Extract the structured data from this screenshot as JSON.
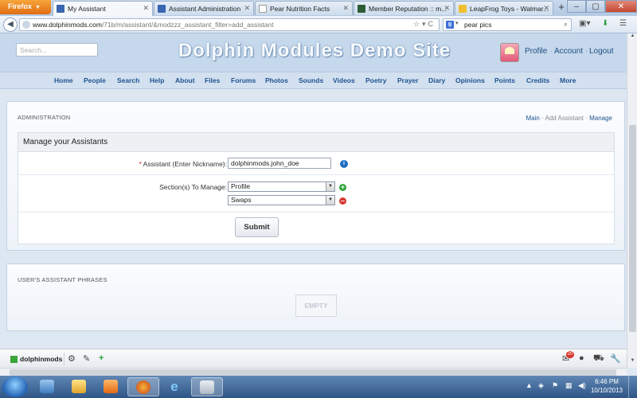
{
  "browser": {
    "app_button": "Firefox",
    "tabs": [
      {
        "label": "My Assistant",
        "active": true,
        "color": "#3a65b0"
      },
      {
        "label": "Assistant Administration",
        "active": false,
        "color": "#3a65b0"
      },
      {
        "label": "Pear Nutrition Facts",
        "active": false,
        "color": "#dddddd"
      },
      {
        "label": "Member Reputation :: m...",
        "active": false,
        "color": "#2b5c36"
      },
      {
        "label": "LeapFrog Toys - Walmar...",
        "active": false,
        "color": "#f0c030"
      }
    ],
    "url_domain": "www.dolphinmods.com",
    "url_path": "/71b/m/assistant/&modzzz_assistant_filter=add_assistant",
    "search_query": "pear pics",
    "search_engine_letter": "g"
  },
  "site": {
    "search_placeholder": "Search...",
    "title": "Dolphin Modules Demo Site",
    "account_links": [
      "Profile",
      "Account",
      "Logout"
    ],
    "nav": [
      "Home",
      "People",
      "Search",
      "Help",
      "About",
      "Files",
      "Forums",
      "Photos",
      "Sounds",
      "Videos",
      "Poetry",
      "Prayer",
      "Diary",
      "Opinions",
      "Points",
      "Credits",
      "More"
    ]
  },
  "admin": {
    "title": "ADMINISTRATION",
    "links": [
      "Main",
      "Add Assistant",
      "Manage"
    ],
    "form_title": "Manage your Assistants",
    "assistant_label": "Assistant (Enter Nickname):",
    "required_mark": "*",
    "assistant_value": "dolphinmods.john_doe",
    "sections_label": "Section(s) To Manage:",
    "section_1": "Profile",
    "section_2": "Swaps",
    "submit_label": "Submit"
  },
  "phrases": {
    "title": "USER'S ASSISTANT PHRASES",
    "empty_label": "EMPTY"
  },
  "dock": {
    "username": "dolphinmods",
    "notification_count": "20"
  },
  "taskbar": {
    "time": "6:46 PM",
    "date": "10/10/2013"
  }
}
